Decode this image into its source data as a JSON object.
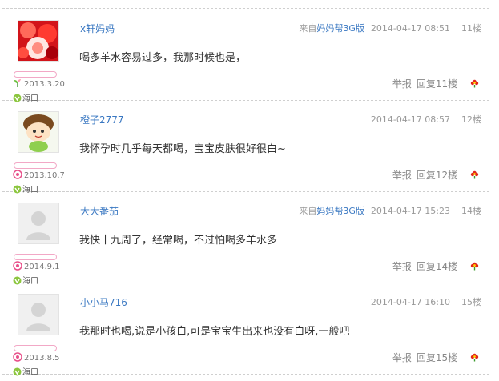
{
  "posts": [
    {
      "username": "x轩妈妈",
      "source_prefix": "来自",
      "source_link": "妈妈帮3G版",
      "time": "2014-04-17 08:51",
      "floor": "11楼",
      "content": "喝多羊水容易过多，我那时候也是，",
      "reg_date": "2013.3.20",
      "location": "海口",
      "report": "举报",
      "reply": "回复11楼",
      "avatar_icon": "red-flowers-avatar-icon",
      "reg_icon": "growth-icon"
    },
    {
      "username": "橙子2777",
      "time": "2014-04-17 08:57",
      "floor": "12楼",
      "content": "我怀孕时几乎每天都喝，宝宝皮肤很好很白~",
      "reg_date": "2013.10.7",
      "location": "海口",
      "report": "举报",
      "reply": "回复12楼",
      "avatar_icon": "cartoon-avatar-icon",
      "reg_icon": "level-badge-icon"
    },
    {
      "username": "大大番茄",
      "source_prefix": "来自",
      "source_link": "妈妈帮3G版",
      "time": "2014-04-17 15:23",
      "floor": "14楼",
      "content": "我快十九周了，经常喝，不过怕喝多羊水多",
      "reg_date": "2014.9.1",
      "location": "海口",
      "report": "举报",
      "reply": "回复14楼",
      "avatar_icon": "default-avatar-icon",
      "reg_icon": "level-badge-icon"
    },
    {
      "username": "小小马716",
      "time": "2014-04-17 16:10",
      "floor": "15楼",
      "content": "我那时也喝,说是小孩白,可是宝宝生出来也没有白呀,一般吧",
      "reg_date": "2013.8.5",
      "location": "海口",
      "report": "举报",
      "reply": "回复15楼",
      "avatar_icon": "default-avatar-icon",
      "reg_icon": "level-badge-icon"
    }
  ],
  "colors": {
    "link": "#3a78c2",
    "divider": "#cfcfcf",
    "level_bar": "#f2a8c6",
    "flower": "#e0261b"
  }
}
